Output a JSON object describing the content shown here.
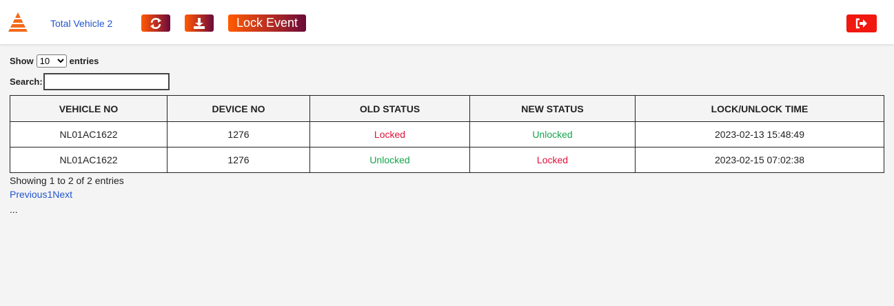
{
  "header": {
    "total_vehicle_label": "Total Vehicle 2",
    "refresh_icon": "refresh-icon",
    "download_icon": "download-icon",
    "lock_event_label": "Lock Event",
    "logout_icon": "sign-out-icon",
    "brand_colors": {
      "gradient_start": "#ff5a00",
      "gradient_end": "#6a0a3a",
      "logout": "#f0180f"
    }
  },
  "controls": {
    "show_label": "Show",
    "entries_value": "10",
    "entries_label": "entries",
    "search_label": "Search:",
    "search_value": ""
  },
  "table": {
    "columns": [
      "VEHICLE NO",
      "DEVICE NO",
      "OLD STATUS",
      "NEW STATUS",
      "LOCK/UNLOCK TIME"
    ],
    "rows": [
      {
        "vehicle_no": "NL01AC1622",
        "device_no": "1276",
        "old_status": "Locked",
        "new_status": "Unlocked",
        "time": "2023-02-13 15:48:49"
      },
      {
        "vehicle_no": "NL01AC1622",
        "device_no": "1276",
        "old_status": "Unlocked",
        "new_status": "Locked",
        "time": "2023-02-15 07:02:38"
      }
    ],
    "status_colors": {
      "Locked": "#e01038",
      "Unlocked": "#13a54a"
    }
  },
  "footer": {
    "info": "Showing 1 to 2 of 2 entries",
    "previous": "Previous",
    "page": "1",
    "next": "Next",
    "ellipsis": "..."
  }
}
